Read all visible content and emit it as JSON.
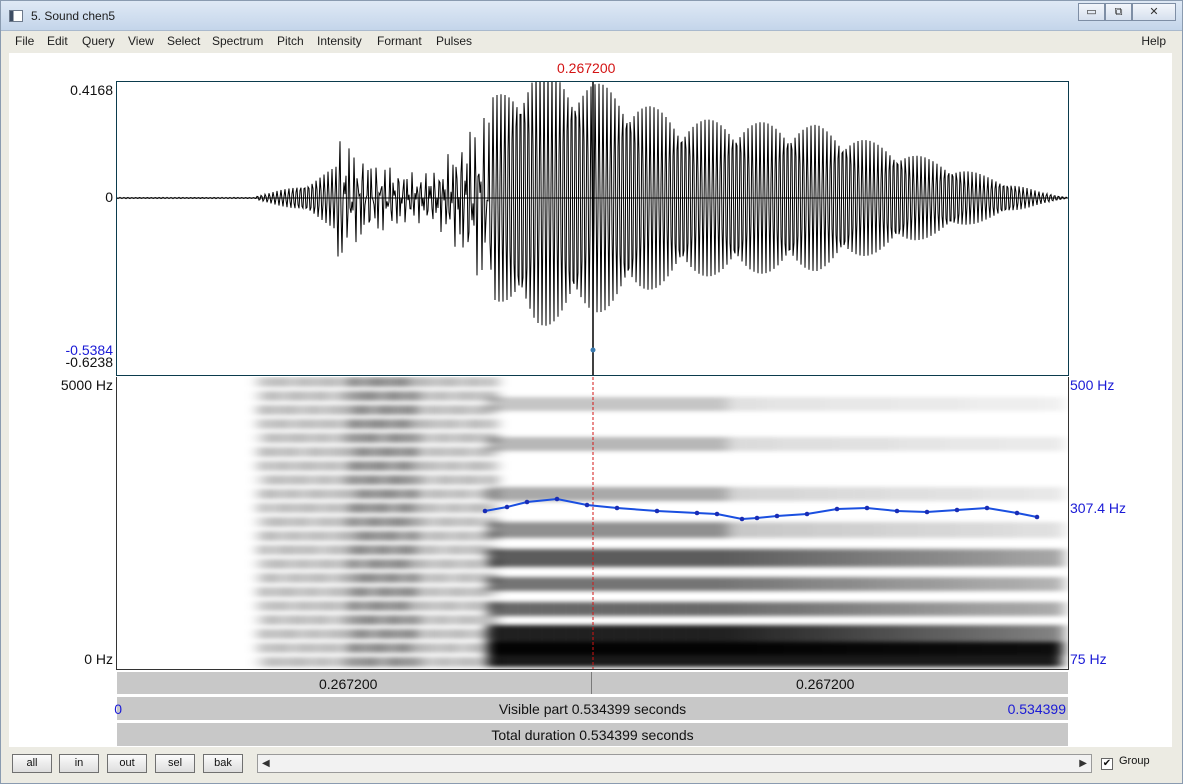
{
  "window": {
    "title": "5. Sound chen5",
    "minimize": "▭",
    "restore": "⧉",
    "close": "✕"
  },
  "menubar": {
    "items": [
      "File",
      "Edit",
      "Query",
      "View",
      "Select",
      "Spectrum",
      "Pitch",
      "Intensity",
      "Formant",
      "Pulses"
    ],
    "help": "Help"
  },
  "cursor": {
    "time_label": "0.267200"
  },
  "waveform": {
    "ymax": "0.4168",
    "zero": "0",
    "ymin_blue": "-0.5384",
    "ymin": "-0.6238"
  },
  "spectrogram": {
    "freq_top": "5000 Hz",
    "freq_bottom": "0 Hz",
    "pitch_top": "500 Hz",
    "pitch_mid": "307.4 Hz",
    "pitch_bottom": "75 Hz"
  },
  "time_axis": {
    "left": "0.267200",
    "right": "0.267200",
    "start": "0",
    "end": "0.534399",
    "visible_part": "Visible part 0.534399 seconds",
    "total_duration": "Total duration 0.534399 seconds"
  },
  "nav_buttons": [
    "all",
    "in",
    "out",
    "sel",
    "bak"
  ],
  "group_label": "Group",
  "group_checked": "✔",
  "colors": {
    "cursor": "#d31414",
    "pitch": "#1a1ad6",
    "axis_blue": "#1a1ad6"
  }
}
